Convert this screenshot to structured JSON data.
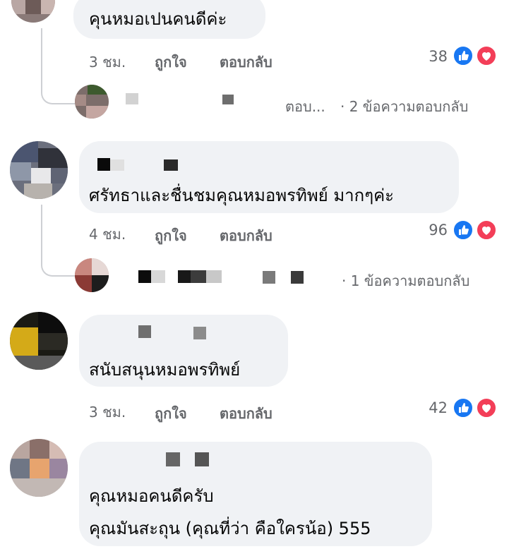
{
  "comments": [
    {
      "text": "คุนหมอเปนคนดีค่ะ",
      "time": "3 ชม.",
      "like_label": "ถูกใจ",
      "reply_label": "ตอบกลับ",
      "reaction_count": "38",
      "reply_preview_snippet": "ตอบ...",
      "reply_summary": "· 2 ข้อความตอบกลับ"
    },
    {
      "text": "ศรัทธาและชื่นชมคุณหมอพรทิพย์ มากๆค่ะ",
      "time": "4 ชม.",
      "like_label": "ถูกใจ",
      "reply_label": "ตอบกลับ",
      "reaction_count": "96",
      "reply_summary": "· 1 ข้อความตอบกลับ"
    },
    {
      "text": "สนับสนุนหมอพรทิพย์",
      "time": "3 ชม.",
      "like_label": "ถูกใจ",
      "reply_label": "ตอบกลับ",
      "reaction_count": "42"
    },
    {
      "text_line1": "คุณหมอคนดีครับ",
      "text_line2": "คุณมันสะถุน (คุณที่ว่า คือใครน้อ) 555"
    }
  ],
  "reaction_icons": [
    "like-icon",
    "love-icon"
  ],
  "colors": {
    "like": "#1877f2",
    "love": "#f33e58",
    "bubble": "#f0f2f5",
    "meta": "#65676b"
  }
}
